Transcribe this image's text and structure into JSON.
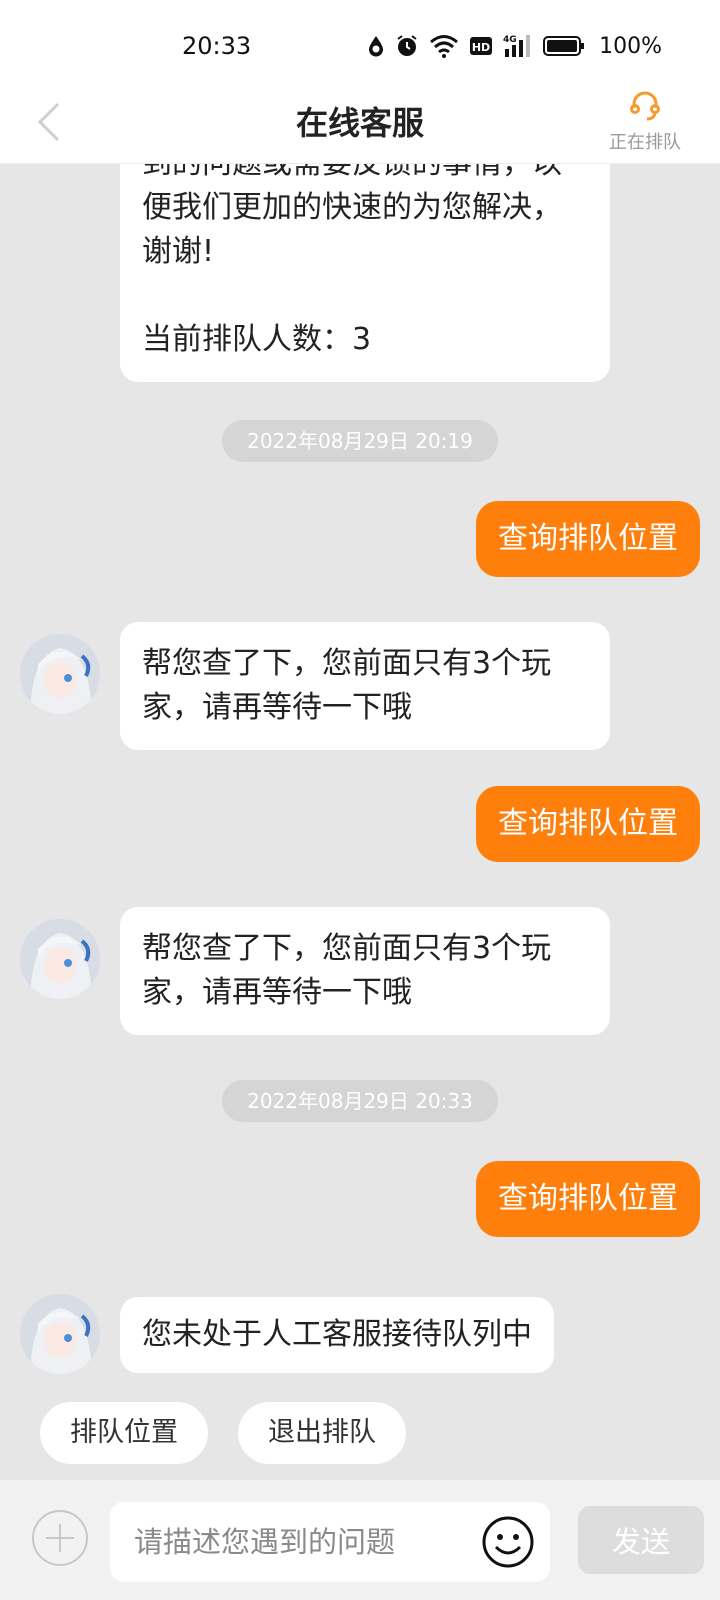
{
  "status_bar": {
    "time": "20:33",
    "battery": "100%",
    "icons": [
      "drop-icon",
      "alarm-icon",
      "wifi-icon",
      "hd-icon",
      "4g-signal-icon",
      "battery-icon"
    ]
  },
  "header": {
    "title": "在线客服",
    "queue_status": "正在排队",
    "back_icon": "chevron-left-icon",
    "queue_icon": "headset-icon"
  },
  "messages": [
    {
      "side": "left",
      "lines": [
        "到的问题或需要反馈的事情，以",
        "便我们更加的快速的为您解决，",
        "谢谢!",
        "",
        "当前排队人数：3"
      ]
    },
    {
      "type": "timestamp",
      "text": "2022年08月29日 20:19"
    },
    {
      "side": "right",
      "text": "查询排队位置"
    },
    {
      "side": "left",
      "lines": [
        "帮您查了下，您前面只有3个玩",
        "家，请再等待一下哦"
      ]
    },
    {
      "side": "right",
      "text": "查询排队位置"
    },
    {
      "side": "left",
      "lines": [
        "帮您查了下，您前面只有3个玩",
        "家，请再等待一下哦"
      ]
    },
    {
      "type": "timestamp",
      "text": "2022年08月29日 20:33"
    },
    {
      "side": "right",
      "text": "查询排队位置"
    },
    {
      "side": "left",
      "lines": [
        "您未处于人工客服接待队列中"
      ]
    }
  ],
  "quick_replies": [
    "排队位置",
    "退出排队"
  ],
  "input": {
    "placeholder": "请描述您遇到的问题",
    "send_label": "发送"
  },
  "colors": {
    "accent": "#ff7f0c",
    "chat_background": "#e6e6e6",
    "timestamp_pill": "#d5d5d5"
  }
}
